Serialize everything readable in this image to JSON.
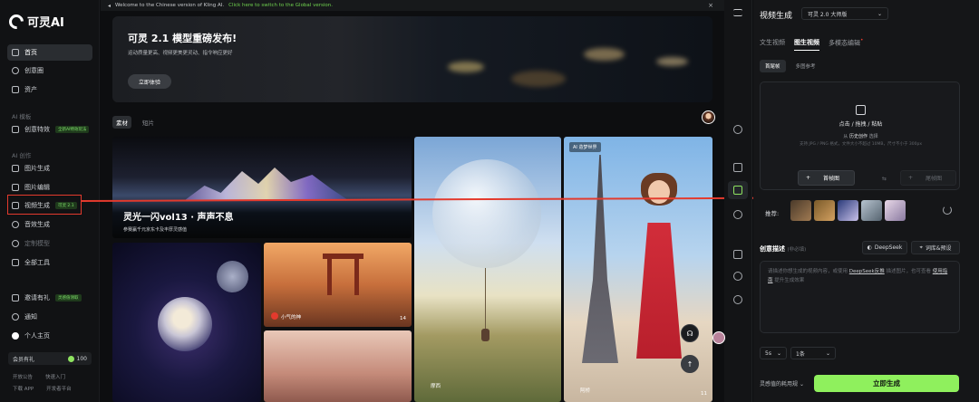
{
  "sidebar": {
    "logo": "可灵AI",
    "items": [
      {
        "label": "首页"
      },
      {
        "label": "创意圈"
      },
      {
        "label": "资产"
      }
    ],
    "section_models": "AI 模板",
    "model_item": {
      "label": "创意特效",
      "badge": "全新AI特效玩法"
    },
    "section_create": "AI 创作",
    "create_items": [
      {
        "label": "图片生成"
      },
      {
        "label": "图片编辑"
      },
      {
        "label": "视频生成",
        "badge": "可灵 2.1"
      },
      {
        "label": "音效生成"
      },
      {
        "label": "定制模型"
      },
      {
        "label": "全部工具"
      }
    ],
    "bottom_items": [
      {
        "label": "邀请有礼",
        "badge": "灵感值领取"
      },
      {
        "label": "通知"
      },
      {
        "label": "个人主页"
      }
    ],
    "member": {
      "label": "会员有礼",
      "credits": "100"
    },
    "footer_links": [
      "开放公告",
      "快速入门",
      "下载 APP",
      "开发者平台"
    ]
  },
  "main": {
    "notice": {
      "text": "Welcome to the Chinese version of Kling AI.",
      "link": "Click here to switch to the Global version.",
      "close": "×"
    },
    "banner": {
      "title": "可灵 2.1 模型重磅发布!",
      "subtitle": "运动质量更高、视频更美更灵动、指令响应更好",
      "button": "立即体验"
    },
    "tabs": [
      "素材",
      "短片"
    ],
    "cards": [
      {
        "title": "灵光一闪vol13 · 声声不息",
        "subtitle": "参赛赢千元京东卡及丰厚灵感值"
      },
      {
        "user": "小气的神",
        "likes": "14"
      },
      {
        "user": "摩西"
      },
      {
        "badge": "AI 造梦世界",
        "user": "阿桥",
        "likes": "11"
      }
    ]
  },
  "panel": {
    "title": "视频生成",
    "model": "可灵 2.0 大师版",
    "tabs": [
      "文生视频",
      "图生视频",
      "多模态编辑"
    ],
    "subtabs": [
      "首尾帧",
      "多图参考"
    ],
    "upload": {
      "main": "点击 / 拖拽 / 粘贴",
      "history_prefix": "从",
      "history_link": "历史创作",
      "history_suffix": "选择",
      "note": "支持 JPG / PNG 格式，文件大小不超过 10MB，尺寸不小于 300px",
      "first_frame": "首帧图",
      "last_frame": "尾帧图"
    },
    "recommend_label": "推荐:",
    "prompt": {
      "label": "创意描述",
      "optional": "(非必填)",
      "deepseek": "DeepSeek",
      "library": "词库&预设",
      "placeholder_1": "请描述你想生成的视频内容，或使用",
      "deepseek_link": "DeepSeek反推",
      "placeholder_2": "描述图片，也可查看",
      "guide_link": "使用指南",
      "placeholder_3": "提升生成效果"
    },
    "duration": "5s",
    "count": "1条",
    "footer_label": "灵感值的耗用规",
    "generate": "立即生成"
  },
  "colors": {
    "accent": "#8ff05d",
    "annotation": "#e33a2d",
    "bg": "#0d0e10"
  }
}
